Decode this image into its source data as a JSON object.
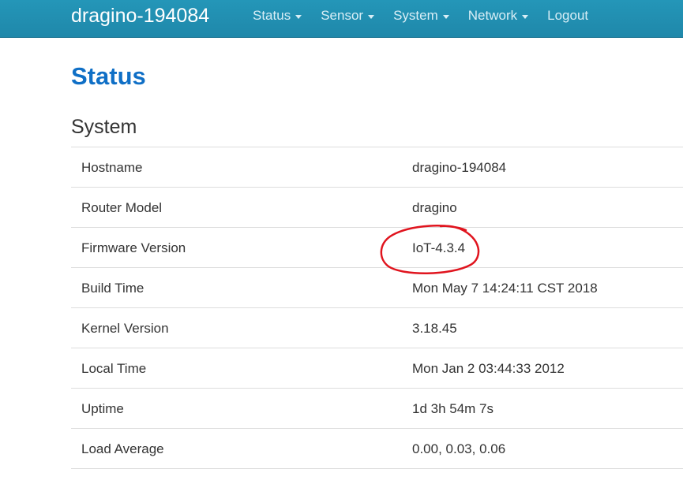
{
  "header": {
    "brand": "dragino-194084",
    "menu": [
      {
        "label": "Status",
        "dropdown": true
      },
      {
        "label": "Sensor",
        "dropdown": true
      },
      {
        "label": "System",
        "dropdown": true
      },
      {
        "label": "Network",
        "dropdown": true
      },
      {
        "label": "Logout",
        "dropdown": false
      }
    ]
  },
  "page": {
    "title": "Status",
    "section": "System"
  },
  "system_table": [
    {
      "label": "Hostname",
      "value": "dragino-194084"
    },
    {
      "label": "Router Model",
      "value": "dragino"
    },
    {
      "label": "Firmware Version",
      "value": "IoT-4.3.4"
    },
    {
      "label": "Build Time",
      "value": "Mon May 7 14:24:11 CST 2018"
    },
    {
      "label": "Kernel Version",
      "value": "3.18.45"
    },
    {
      "label": "Local Time",
      "value": "Mon Jan 2 03:44:33 2012"
    },
    {
      "label": "Uptime",
      "value": "1d 3h 54m 7s"
    },
    {
      "label": "Load Average",
      "value": "0.00, 0.03, 0.06"
    }
  ],
  "colors": {
    "navbar": "#2193b4",
    "title": "#0f6fc6",
    "annotation": "#e0141e"
  }
}
